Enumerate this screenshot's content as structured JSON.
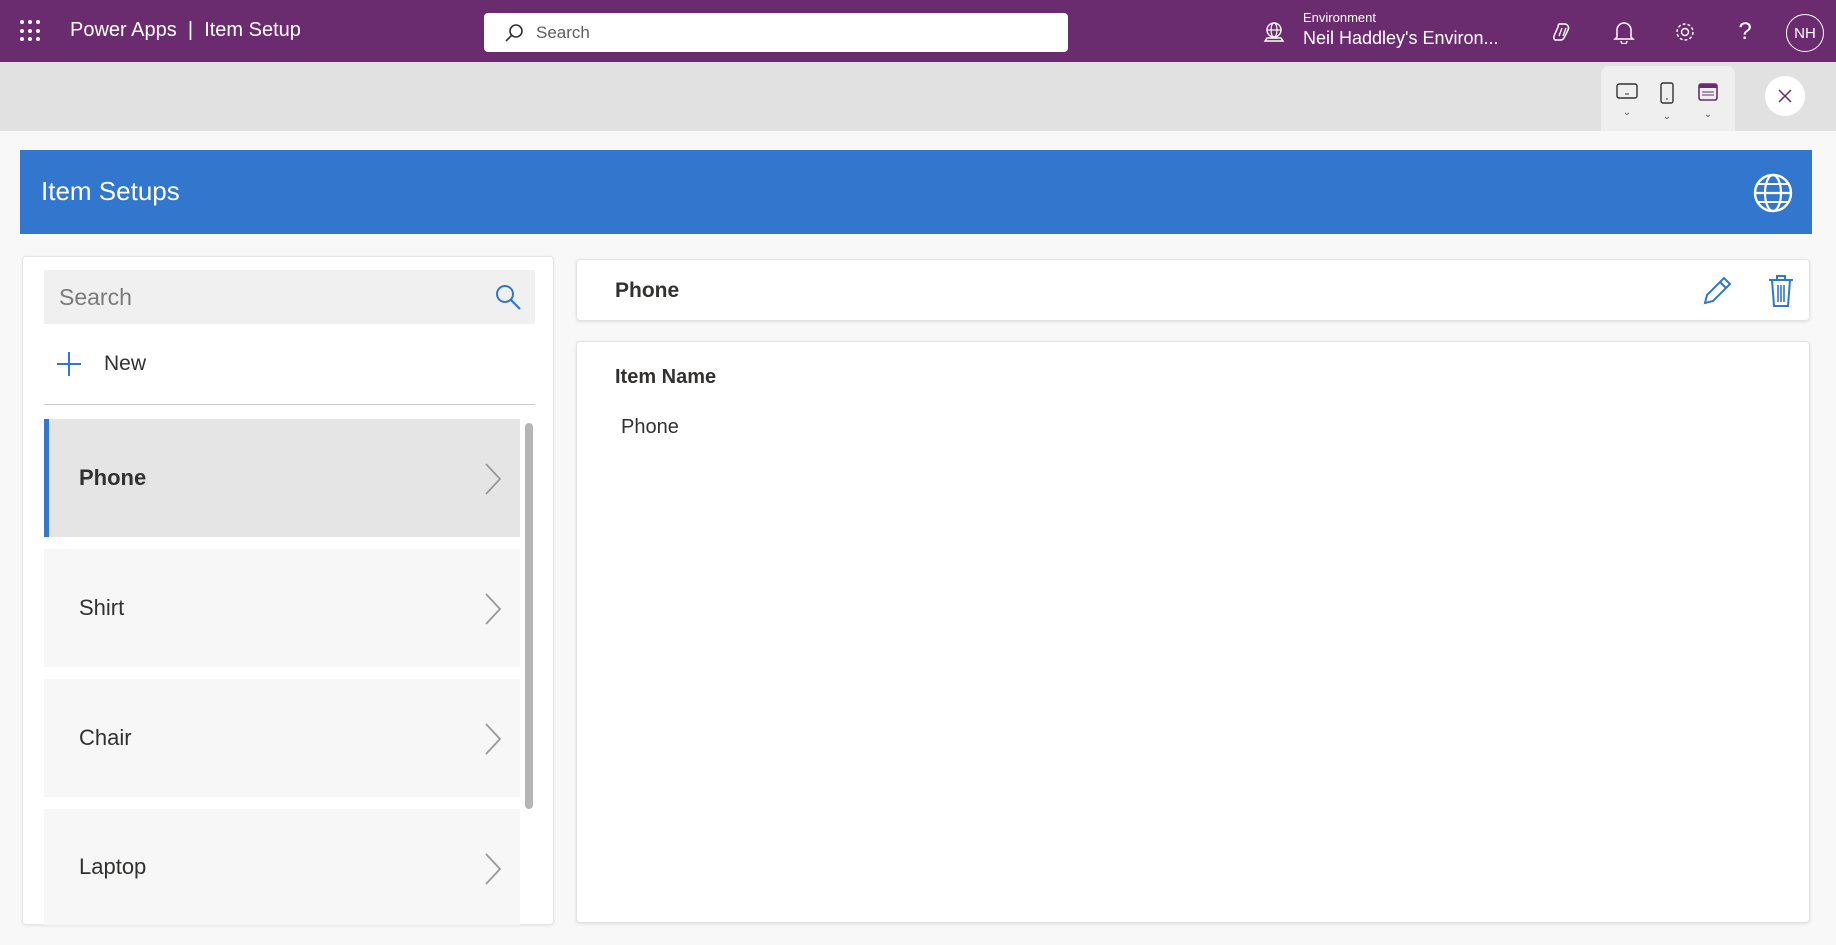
{
  "topbar": {
    "app": "Power Apps",
    "separator": "|",
    "page": "Item Setup",
    "search_placeholder": "Search",
    "env_label": "Environment",
    "env_name": "Neil Haddley's Environ...",
    "avatar": "NH"
  },
  "colors": {
    "topbar": "#6b2c6f",
    "header": "#3277cd"
  },
  "app": {
    "header_title": "Item Setups",
    "search_placeholder": "Search",
    "new_label": "New",
    "items": [
      {
        "label": "Phone"
      },
      {
        "label": "Shirt"
      },
      {
        "label": "Chair"
      },
      {
        "label": "Laptop"
      }
    ],
    "selected_title": "Phone",
    "field_label": "Item Name",
    "field_value": "Phone"
  }
}
